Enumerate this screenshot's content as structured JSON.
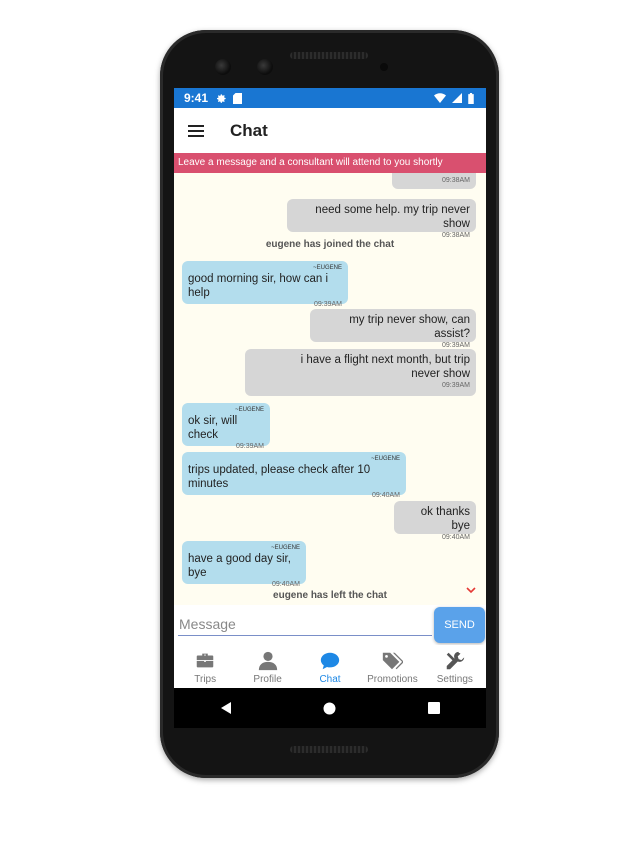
{
  "status_bar": {
    "time": "9:41"
  },
  "app_bar": {
    "title": "Chat"
  },
  "banner": {
    "text": "Leave a message and a consultant will attend to you shortly"
  },
  "messages": [
    {
      "type": "out",
      "text": "",
      "time": "09:38AM"
    },
    {
      "type": "out",
      "text": "need some help. my trip never show",
      "time": "09:38AM"
    },
    {
      "type": "system",
      "text": "eugene has joined the chat"
    },
    {
      "type": "in",
      "sender": "~EUGENE",
      "text": "good morning sir, how can i help",
      "time": "09:39AM"
    },
    {
      "type": "out",
      "text": "my trip never show, can assist?",
      "time": "09:39AM"
    },
    {
      "type": "out",
      "text": "i have a flight next month, but trip never show",
      "time": "09:39AM"
    },
    {
      "type": "in",
      "sender": "~EUGENE",
      "text": "ok sir, will check",
      "time": "09:39AM"
    },
    {
      "type": "in",
      "sender": "~EUGENE",
      "text": "trips updated, please check after 10 minutes",
      "time": "09:40AM"
    },
    {
      "type": "out",
      "text": "ok thanks bye",
      "time": "09:40AM"
    },
    {
      "type": "in",
      "sender": "~EUGENE",
      "text": "have a good day sir, bye",
      "time": "09:40AM"
    },
    {
      "type": "system",
      "text": "eugene has left the chat"
    }
  ],
  "input": {
    "placeholder": "Message",
    "send_label": "SEND"
  },
  "tabs": [
    {
      "label": "Trips",
      "icon": "briefcase-icon",
      "active": false
    },
    {
      "label": "Profile",
      "icon": "person-icon",
      "active": false
    },
    {
      "label": "Chat",
      "icon": "chat-bubble-icon",
      "active": true
    },
    {
      "label": "Promotions",
      "icon": "tags-icon",
      "active": false
    },
    {
      "label": "Settings",
      "icon": "tools-icon",
      "active": false
    }
  ],
  "colors": {
    "status_bar": "#1976d2",
    "banner": "#d9506f",
    "incoming_bubble": "#b3dded",
    "outgoing_bubble": "#d6d6d6",
    "active_tab": "#1e88e5",
    "send_button": "#5aa2ea"
  }
}
